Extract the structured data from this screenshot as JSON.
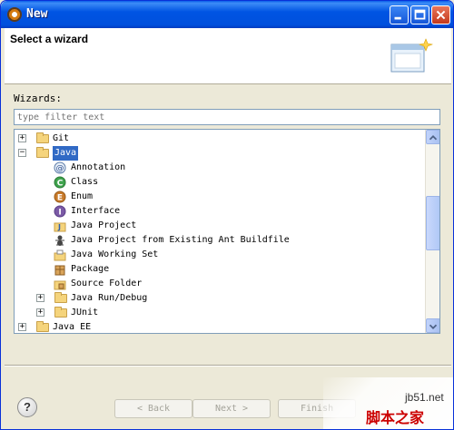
{
  "window": {
    "title": "New"
  },
  "banner": {
    "title": "Select a wizard"
  },
  "wizards": {
    "label": "Wizards:",
    "filter_placeholder": "type filter text"
  },
  "tree": [
    {
      "label": "Git",
      "level": 0,
      "expander": "+",
      "icon": "folder-icon"
    },
    {
      "label": "Java",
      "level": 0,
      "expander": "−",
      "icon": "folder-open-icon",
      "selected": true
    },
    {
      "label": "Annotation",
      "level": 1,
      "icon": "annotation-icon"
    },
    {
      "label": "Class",
      "level": 1,
      "icon": "class-icon"
    },
    {
      "label": "Enum",
      "level": 1,
      "icon": "enum-icon"
    },
    {
      "label": "Interface",
      "level": 1,
      "icon": "interface-icon"
    },
    {
      "label": "Java Project",
      "level": 1,
      "icon": "java-project-icon"
    },
    {
      "label": "Java Project from Existing Ant Buildfile",
      "level": 1,
      "icon": "ant-icon"
    },
    {
      "label": "Java Working Set",
      "level": 1,
      "icon": "working-set-icon"
    },
    {
      "label": "Package",
      "level": 1,
      "icon": "package-icon"
    },
    {
      "label": "Source Folder",
      "level": 1,
      "icon": "source-folder-icon"
    },
    {
      "label": "Java Run/Debug",
      "level": 1,
      "expander": "+",
      "icon": "folder-icon"
    },
    {
      "label": "JUnit",
      "level": 1,
      "expander": "+",
      "icon": "folder-icon"
    },
    {
      "label": "Java EE",
      "level": 0,
      "expander": "+",
      "icon": "folder-icon"
    }
  ],
  "buttons": {
    "help": "?",
    "back": "< Back",
    "next": "Next >",
    "finish": "Finish"
  },
  "watermark": {
    "site": "jb51.net",
    "cn": "脚本之家"
  },
  "colors": {
    "titlebar": "#0054e3",
    "selection": "#316ac5",
    "dialog_bg": "#ece9d8"
  }
}
